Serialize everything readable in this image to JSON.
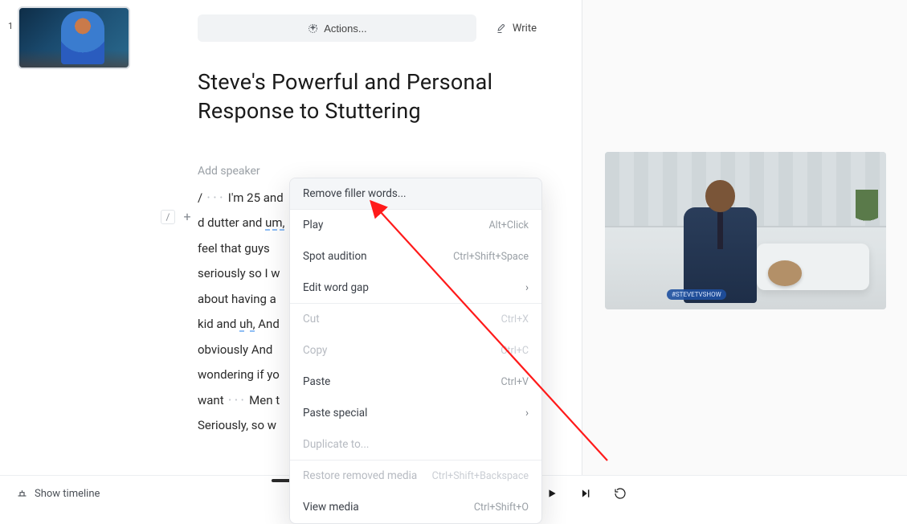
{
  "thumb": {
    "index": "1"
  },
  "topbar": {
    "actions_label": "Actions...",
    "write_label": "Write"
  },
  "title": "Steve's Powerful and Personal Response to Stuttering",
  "speaker_hint": "Add speaker",
  "transcript": {
    "l1a": "/ ",
    "l1b": " I'm 25 and",
    "l2a": "d dutter and ",
    "l2b": "um,",
    "l3": "feel that   guys",
    "l4": "seriously so I w",
    "l5": "about having a",
    "l6a": "kid and ",
    "l6b": "uh,",
    "l6c": " And",
    "l7": "obviously And ",
    "l8": "wondering if yo",
    "l9a": "want ",
    "l9b": " Men t",
    "l10": "Seriously, so w"
  },
  "context_menu": {
    "remove_filler": "Remove filler words...",
    "play": "Play",
    "play_sc": "Alt+Click",
    "spot": "Spot audition",
    "spot_sc": "Ctrl+Shift+Space",
    "edit_gap": "Edit word gap",
    "cut": "Cut",
    "cut_sc": "Ctrl+X",
    "copy": "Copy",
    "copy_sc": "Ctrl+C",
    "paste": "Paste",
    "paste_sc": "Ctrl+V",
    "paste_special": "Paste special",
    "duplicate": "Duplicate to...",
    "restore": "Restore removed media",
    "restore_sc": "Ctrl+Shift+Backspace",
    "view_media": "View media",
    "view_media_sc": "Ctrl+Shift+O"
  },
  "preview": {
    "badge": "#STEVETVSHOW"
  },
  "bottom": {
    "show_timeline": "Show timeline"
  }
}
